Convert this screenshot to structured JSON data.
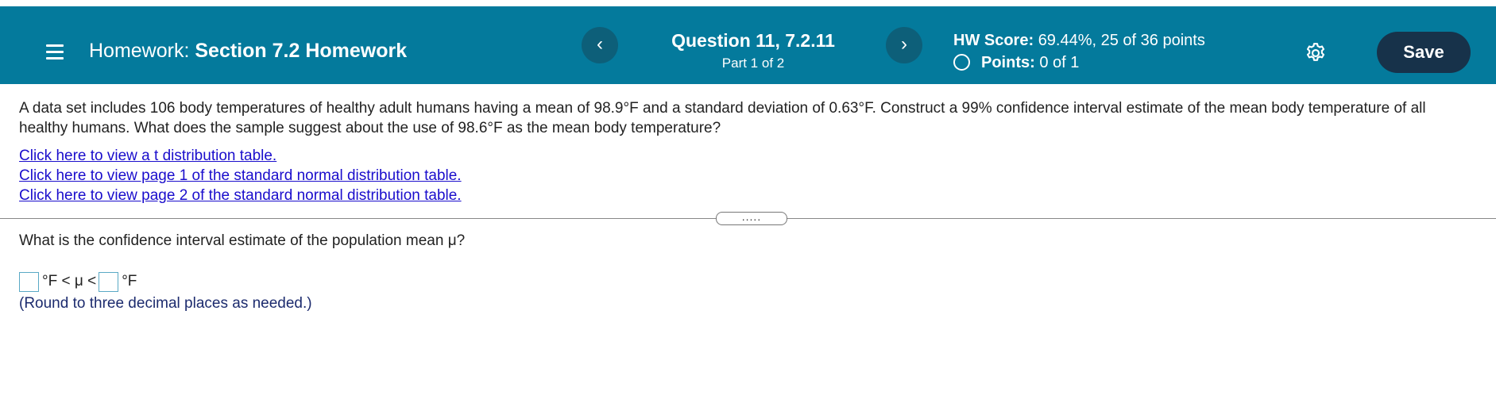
{
  "header": {
    "homework_label": "Homework:",
    "homework_name": "Section 7.2 Homework",
    "prev_symbol": "‹",
    "next_symbol": "›",
    "question_title": "Question 11, 7.2.11",
    "question_part": "Part 1 of 2",
    "score_label": "HW Score:",
    "score_value": "69.44%, 25 of 36 points",
    "points_label": "Points:",
    "points_value": "0 of 1",
    "save_label": "Save",
    "icons": [
      "menu-icon",
      "chevron-left-icon",
      "chevron-right-icon",
      "radio-empty-icon",
      "gear-icon"
    ]
  },
  "colors": {
    "header_bg": "#047a9c",
    "nav_button_bg": "#0d5f79",
    "save_button_bg": "#17324a",
    "link": "#1a0dcc",
    "answer_border": "#5aa9c5"
  },
  "question": {
    "text": "A data set includes 106 body temperatures of healthy adult humans having a mean of 98.9°F and a standard deviation of 0.63°F. Construct a 99% confidence interval estimate of the mean body temperature of all healthy humans. What does the sample suggest about the use of 98.6°F as the mean body temperature?",
    "links": [
      "Click here to view a t distribution table.",
      "Click here to view page 1 of the standard normal distribution table.",
      "Click here to view page 2 of the standard normal distribution table."
    ]
  },
  "divider": {
    "handle_label": "....."
  },
  "answer": {
    "prompt": "What is the confidence interval estimate of the population mean μ?",
    "lower_value": "",
    "upper_value": "",
    "middle_text": "°F < μ <",
    "unit_text": "°F",
    "note": "(Round to three decimal places as needed.)"
  }
}
